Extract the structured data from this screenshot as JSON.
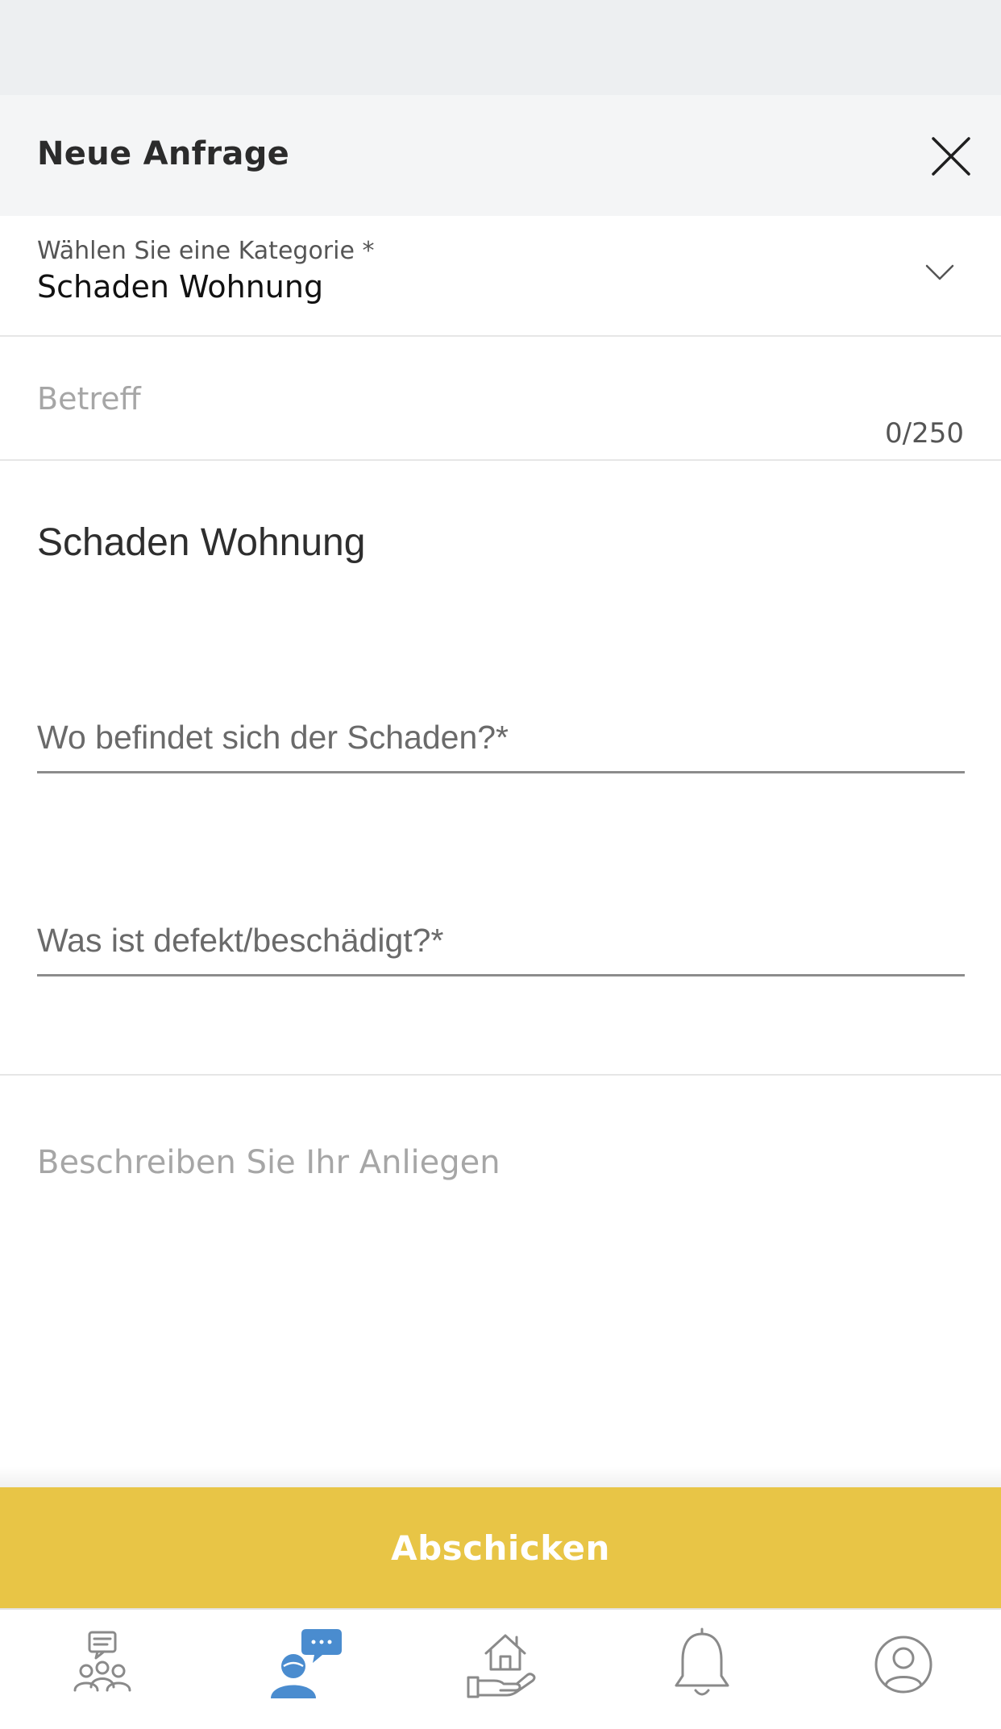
{
  "header": {
    "title": "Neue Anfrage"
  },
  "category": {
    "label": "Wählen Sie eine Kategorie *",
    "value": "Schaden Wohnung"
  },
  "subject": {
    "placeholder": "Betreff",
    "counter": "0/250"
  },
  "form": {
    "section_title": "Schaden Wohnung",
    "fields": [
      {
        "placeholder": "Wo befindet sich der Schaden?*"
      },
      {
        "placeholder": "Was ist defekt/beschädigt?*"
      }
    ]
  },
  "description": {
    "placeholder": "Beschreiben Sie Ihr Anliegen"
  },
  "submit": {
    "label": "Abschicken"
  },
  "tabbar": {
    "tabs": [
      {
        "icon": "community-icon",
        "active": false
      },
      {
        "icon": "chat-request-icon",
        "active": true
      },
      {
        "icon": "home-service-icon",
        "active": false
      },
      {
        "icon": "bell-icon",
        "active": false
      },
      {
        "icon": "profile-icon",
        "active": false
      }
    ],
    "active_color": "#4a8ccf",
    "inactive_color": "#8a8a8a"
  },
  "colors": {
    "accent": "#e8c546",
    "header_bg": "#f4f5f6",
    "status_bar_bg": "#edeff1"
  }
}
